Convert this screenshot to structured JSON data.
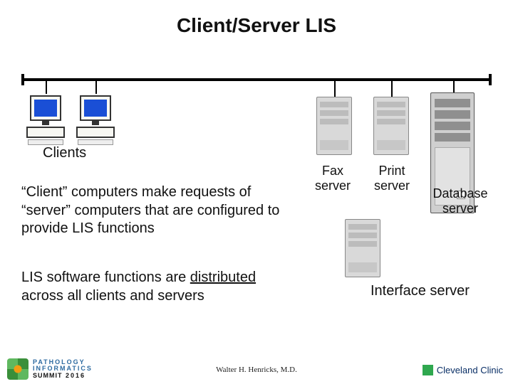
{
  "title": "Client/Server LIS",
  "labels": {
    "clients": "Clients",
    "fax_server": "Fax\nserver",
    "print_server": "Print\nserver",
    "database_server": "Database\nserver",
    "interface_server": "Interface server"
  },
  "paragraphs": {
    "p1_pre": "“Client” computers make requests of “server” computers that are configured to provide LIS functions",
    "p2_pre": "LIS software functions are ",
    "p2_ul": "distributed",
    "p2_post": " across all clients and servers"
  },
  "footer": {
    "author": "Walter H. Henricks, M.D.",
    "conf_line1": "PATHOLOGY",
    "conf_line2": "INFORMATICS",
    "conf_line3a": "SUMMIT",
    "conf_line3b": "2016",
    "clinic": "Cleveland Clinic"
  }
}
